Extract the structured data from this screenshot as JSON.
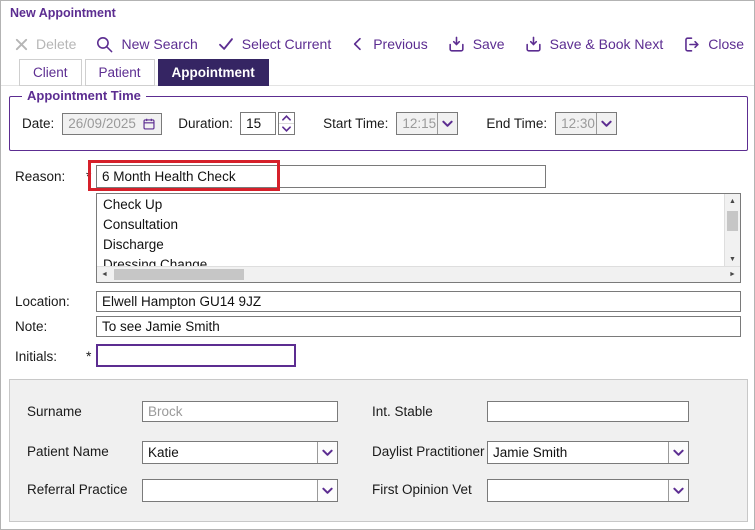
{
  "window": {
    "title": "New Appointment"
  },
  "toolbar": {
    "items": [
      {
        "label": "Delete",
        "icon": "x-icon",
        "disabled": true
      },
      {
        "label": "New Search",
        "icon": "search-icon",
        "disabled": false
      },
      {
        "label": "Select Current",
        "icon": "check-icon",
        "disabled": false
      },
      {
        "label": "Previous",
        "icon": "chevron-left-icon",
        "disabled": false
      },
      {
        "label": "Save",
        "icon": "save-tray-icon",
        "disabled": false
      },
      {
        "label": "Save & Book Next",
        "icon": "save-tray-icon",
        "disabled": false
      },
      {
        "label": "Close",
        "icon": "exit-arrow-icon",
        "disabled": false
      }
    ]
  },
  "tabs": [
    {
      "label": "Client",
      "active": false
    },
    {
      "label": "Patient",
      "active": false
    },
    {
      "label": "Appointment",
      "active": true
    }
  ],
  "appointment_time": {
    "group_title": "Appointment Time",
    "date": {
      "label": "Date:",
      "value": "26/09/2025"
    },
    "duration": {
      "label": "Duration:",
      "value": "15"
    },
    "start_time": {
      "label": "Start Time:",
      "value": "12:15"
    },
    "end_time": {
      "label": "End Time:",
      "value": "12:30"
    }
  },
  "fields": {
    "required_marker": "*",
    "reason": {
      "label": "Reason:",
      "value": "6 Month Health Check"
    },
    "reason_options": [
      "Check Up",
      "Consultation",
      "Discharge",
      "Dressing Change"
    ],
    "location": {
      "label": "Location:",
      "value": "Elwell Hampton GU14 9JZ"
    },
    "note": {
      "label": "Note:",
      "value": "To see Jamie Smith"
    },
    "initials": {
      "label": "Initials:",
      "value": ""
    }
  },
  "patient_section": {
    "surname": {
      "label": "Surname",
      "value": "Brock"
    },
    "int_stable": {
      "label": "Int. Stable",
      "value": ""
    },
    "patient_name": {
      "label": "Patient Name",
      "value": "Katie"
    },
    "daylist_practitioner": {
      "label": "Daylist Practitioner",
      "value": "Jamie Smith"
    },
    "referral_practice": {
      "label": "Referral Practice",
      "value": ""
    },
    "first_opinion_vet": {
      "label": "First Opinion Vet",
      "value": ""
    }
  },
  "colors": {
    "accent_purple": "#5C2D91",
    "active_tab_background": "#352563",
    "annotation_red": "#D6202A",
    "disabled_text": "#9A9A9A"
  }
}
